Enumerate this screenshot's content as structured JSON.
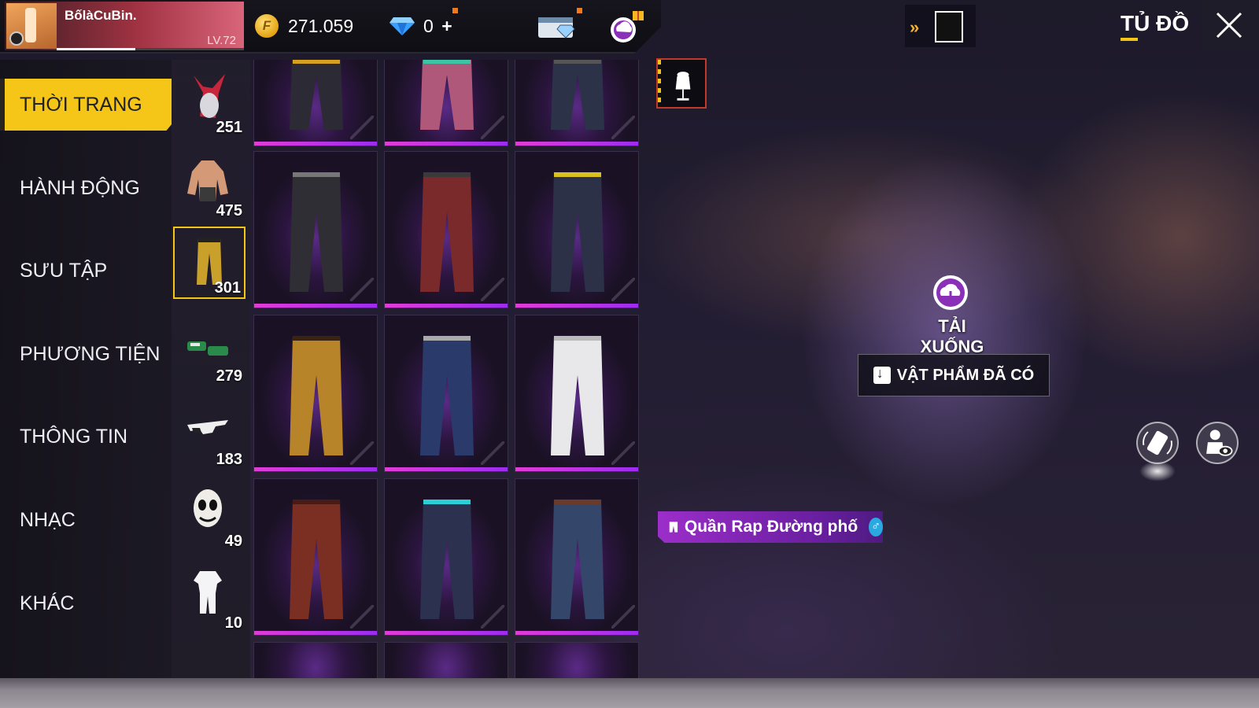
{
  "player": {
    "name": "BốlàCuBin.",
    "level": "LV.72"
  },
  "currency": {
    "coins": "271.059",
    "diamonds": "0",
    "diamond_add": "+"
  },
  "header": {
    "title": "TỦ ĐỒ"
  },
  "categories": [
    {
      "label": "THỜI TRANG",
      "active": true
    },
    {
      "label": "HÀNH ĐỘNG",
      "active": false
    },
    {
      "label": "SƯU TẬP",
      "active": false
    },
    {
      "label": "PHƯƠNG TIỆN",
      "active": false
    },
    {
      "label": "THÔNG TIN",
      "active": false
    },
    {
      "label": "NHẠC",
      "active": false
    },
    {
      "label": "KHÁC",
      "active": false
    }
  ],
  "subcategories": [
    {
      "icon": "mask-head-icon",
      "count": "251"
    },
    {
      "icon": "torso-icon",
      "count": "475"
    },
    {
      "icon": "pants-icon",
      "count": "301",
      "selected": true
    },
    {
      "icon": "shoes-icon",
      "count": "279"
    },
    {
      "icon": "glasses-icon",
      "count": "183"
    },
    {
      "icon": "clown-face-icon",
      "count": "49"
    },
    {
      "icon": "outfit-icon",
      "count": "10"
    }
  ],
  "grid": {
    "rarity_color": "#e23bd8",
    "items": [
      {
        "color": "#2b2a35",
        "accent": "#d6a020"
      },
      {
        "color": "#b0587a",
        "accent": "#3cc4a6"
      },
      {
        "color": "#2c3248",
        "accent": "#555"
      },
      {
        "color": "#2e2e34",
        "accent": "#777"
      },
      {
        "color": "#7a2a2a",
        "accent": "#3a3a3a"
      },
      {
        "color": "#2c3148",
        "accent": "#d8c020"
      },
      {
        "color": "#b8842a",
        "accent": "#3a2410"
      },
      {
        "color": "#2a3a6a",
        "accent": "#aaa"
      },
      {
        "color": "#e8e8ea",
        "accent": "#bbb"
      },
      {
        "color": "#7a2f22",
        "accent": "#4a1a14"
      },
      {
        "color": "#2c3150",
        "accent": "#2ad0d8"
      },
      {
        "color": "#34466a",
        "accent": "#6a3a2a"
      }
    ]
  },
  "preview": {
    "download_label": "TẢI XUỐNG",
    "owned_label": "VẬT PHẨM ĐÃ CÓ",
    "item_name": "Quần Rap Đường phố"
  },
  "colors": {
    "accent": "#f5c518",
    "rarity": "#e23bd8",
    "tag": "#9c2ec9"
  }
}
